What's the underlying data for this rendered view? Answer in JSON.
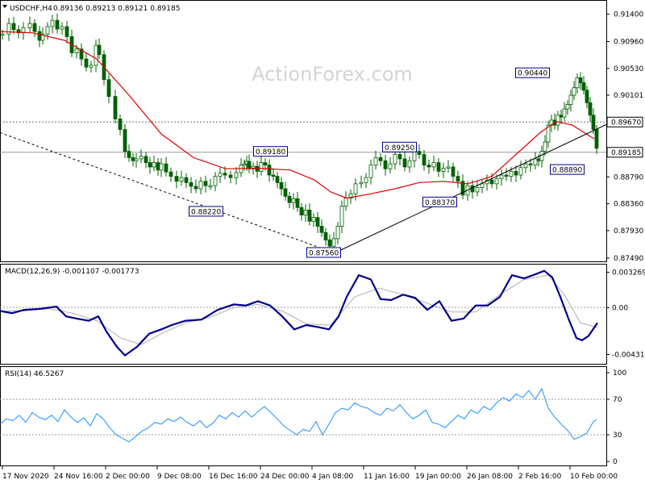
{
  "header": {
    "symbol": "USDCHF,H4",
    "ohlc": "0.89136 0.89213 0.89121 0.89185"
  },
  "watermark": "ActionForex.com",
  "colors": {
    "candle": "#006000",
    "ma": "#e00000",
    "macd": "#00008b",
    "signal": "#b0b0b0",
    "rsi": "#1e90ff",
    "trend": "#000000",
    "watermark": "#d4d4d4"
  },
  "chart_data": [
    {
      "type": "candlestick",
      "title": "USDCHF,H4",
      "ylim": [
        0.8745,
        0.916
      ],
      "price_ticks": [
        "0.91400",
        "0.90960",
        "0.90530",
        "0.90101",
        "0.89670",
        "0.89185",
        "0.88790",
        "0.88360",
        "0.87930",
        "0.87490"
      ],
      "x_labels": [
        "17 Nov 2020",
        "24 Nov 16:00",
        "2 Dec 00:00",
        "9 Dec 08:00",
        "16 Dec 16:00",
        "24 Dec 00:00",
        "4 Jan 08:00",
        "11 Jan 16:00",
        "19 Jan 00:00",
        "26 Jan 08:00",
        "2 Feb 16:00",
        "10 Feb 00:00"
      ],
      "close_series": {
        "x": [
          0,
          8,
          14,
          20,
          26,
          34,
          40,
          46,
          50,
          56,
          62,
          68,
          74,
          80,
          86,
          92,
          98,
          104,
          110,
          116,
          120,
          126,
          132,
          140,
          146,
          152,
          157,
          162,
          166,
          172,
          178,
          183,
          188,
          193,
          197,
          203,
          209,
          216,
          222,
          228,
          234,
          240,
          246,
          252,
          258,
          264,
          270,
          276,
          283,
          290,
          296,
          300,
          303,
          306,
          311,
          316,
          321,
          326,
          331,
          336,
          341,
          346,
          351,
          356,
          361,
          366,
          371,
          376,
          381,
          386,
          391,
          396,
          401,
          406,
          411,
          416,
          421,
          426,
          432,
          438,
          445,
          451,
          457,
          463,
          469,
          475,
          481,
          487,
          493,
          499,
          505,
          511,
          517,
          523,
          529,
          535,
          541,
          547,
          553,
          559,
          565,
          571,
          577,
          583,
          589,
          595,
          601,
          607,
          613,
          619,
          625,
          631,
          637,
          643,
          649,
          655,
          661,
          665,
          669,
          673,
          677,
          681,
          685,
          689,
          693,
          697,
          701,
          705,
          709,
          713,
          717,
          721,
          725,
          729,
          733,
          737
        ],
        "y": [
          0.9108,
          0.9125,
          0.9115,
          0.911,
          0.9118,
          0.9125,
          0.9112,
          0.9098,
          0.9108,
          0.912,
          0.913,
          0.9116,
          0.912,
          0.9104,
          0.9078,
          0.9084,
          0.9068,
          0.9055,
          0.9058,
          0.909,
          0.9075,
          0.9035,
          0.9008,
          0.8972,
          0.8955,
          0.892,
          0.891,
          0.8905,
          0.8908,
          0.8912,
          0.8902,
          0.8895,
          0.8902,
          0.889,
          0.89,
          0.8887,
          0.888,
          0.8872,
          0.8878,
          0.887,
          0.8864,
          0.886,
          0.8872,
          0.8865,
          0.8865,
          0.888,
          0.8885,
          0.8882,
          0.8878,
          0.8886,
          0.8898,
          0.89,
          0.8904,
          0.8892,
          0.8896,
          0.8888,
          0.8902,
          0.8898,
          0.8882,
          0.888,
          0.887,
          0.886,
          0.8848,
          0.8838,
          0.8844,
          0.883,
          0.8818,
          0.8826,
          0.8808,
          0.8814,
          0.88,
          0.879,
          0.8778,
          0.8768,
          0.878,
          0.88,
          0.8832,
          0.8845,
          0.8852,
          0.8868,
          0.887,
          0.8878,
          0.8898,
          0.891,
          0.8905,
          0.8892,
          0.89,
          0.8915,
          0.8908,
          0.8895,
          0.8905,
          0.892,
          0.8915,
          0.8898,
          0.8895,
          0.8902,
          0.8888,
          0.8893,
          0.8895,
          0.888,
          0.8872,
          0.885,
          0.8865,
          0.8855,
          0.8862,
          0.8868,
          0.8874,
          0.8868,
          0.8876,
          0.8882,
          0.888,
          0.8888,
          0.8882,
          0.8894,
          0.89,
          0.8898,
          0.8908,
          0.8905,
          0.892,
          0.8935,
          0.8962,
          0.897,
          0.8962,
          0.8978,
          0.8975,
          0.8988,
          0.8995,
          0.901,
          0.9022,
          0.9038,
          0.903,
          0.9018,
          0.8998,
          0.8978,
          0.8955,
          0.8925
        ]
      },
      "moving_average": {
        "x": [
          0,
          40,
          80,
          120,
          160,
          200,
          240,
          280,
          320,
          360,
          390,
          410,
          430,
          460,
          490,
          520,
          550,
          580,
          610,
          640,
          670,
          690,
          710,
          737
        ],
        "y": [
          0.9112,
          0.911,
          0.9098,
          0.9068,
          0.901,
          0.8948,
          0.891,
          0.8892,
          0.8893,
          0.889,
          0.8874,
          0.8855,
          0.8845,
          0.8852,
          0.886,
          0.887,
          0.8872,
          0.8868,
          0.888,
          0.8915,
          0.895,
          0.8968,
          0.8962,
          0.894
        ]
      },
      "trendlines": [
        {
          "from": [
            0,
            0.895
          ],
          "to": [
            413,
            0.8758
          ]
        },
        {
          "from": [
            413,
            0.8756
          ],
          "to": [
            752,
            0.8963
          ]
        }
      ],
      "horizontal_levels": [
        0.8967,
        0.89185
      ],
      "annotations": [
        {
          "label": "0.89180",
          "at": [
            315,
            0.8918
          ]
        },
        {
          "label": "0.89250",
          "at": [
            475,
            0.8925
          ]
        },
        {
          "label": "0.90440",
          "at": [
            640,
            0.9044
          ]
        },
        {
          "label": "0.88220",
          "at": [
            235,
            0.8822
          ]
        },
        {
          "label": "0.88370",
          "at": [
            525,
            0.8837
          ]
        },
        {
          "label": "0.87560",
          "at": [
            381,
            0.8756
          ]
        },
        {
          "label": "0.88890",
          "at": [
            683,
            0.8889
          ]
        }
      ],
      "current_price": "0.89185",
      "level_label": "0.89670"
    },
    {
      "type": "line",
      "title": "MACD(12,26,9) -0.001107 -0.001773",
      "ylim": [
        -0.0048,
        0.0036
      ],
      "y_ticks": [
        "0.003269",
        "0.00",
        "-0.004316"
      ],
      "series": [
        {
          "name": "MACD",
          "x": [
            0,
            15,
            30,
            50,
            70,
            82,
            95,
            110,
            122,
            132,
            145,
            155,
            170,
            185,
            200,
            213,
            230,
            250,
            270,
            290,
            305,
            320,
            335,
            350,
            365,
            380,
            395,
            408,
            420,
            430,
            445,
            460,
            472,
            485,
            500,
            515,
            530,
            545,
            560,
            575,
            590,
            605,
            620,
            635,
            650,
            665,
            675,
            685,
            695,
            705,
            715,
            722,
            730,
            741
          ],
          "y": [
            -0.0003,
            -0.0005,
            -0.0002,
            -0.0001,
            0.0001,
            -0.0008,
            -0.001,
            -0.0012,
            -0.0008,
            -0.0022,
            -0.0036,
            -0.0044,
            -0.0036,
            -0.0024,
            -0.002,
            -0.0016,
            -0.0012,
            -0.0011,
            -0.0002,
            0.0003,
            0.0002,
            0.0006,
            0.0002,
            -0.0008,
            -0.002,
            -0.0016,
            -0.0018,
            -0.002,
            -0.0008,
            0.001,
            0.003,
            0.0026,
            0.0008,
            0.0007,
            0.0012,
            0.0009,
            -0.0002,
            0.0006,
            -0.0012,
            -0.001,
            0.0002,
            0.0002,
            0.001,
            0.003,
            0.0027,
            0.0031,
            0.0034,
            0.0028,
            0.001,
            -0.001,
            -0.0028,
            -0.003,
            -0.0026,
            -0.0014
          ]
        },
        {
          "name": "Signal",
          "x": [
            0,
            30,
            60,
            90,
            120,
            150,
            175,
            200,
            230,
            260,
            290,
            320,
            350,
            380,
            410,
            440,
            470,
            500,
            530,
            560,
            590,
            620,
            650,
            680,
            700,
            720,
            741
          ],
          "y": [
            -0.0003,
            -0.0003,
            -0.0001,
            -0.0005,
            -0.0012,
            -0.0028,
            -0.0034,
            -0.0024,
            -0.0014,
            -0.0009,
            0.0,
            0.0003,
            -0.0003,
            -0.0015,
            -0.0016,
            0.001,
            0.0018,
            0.0012,
            0.0004,
            -0.0004,
            -0.0004,
            0.0012,
            0.0026,
            0.003,
            0.0012,
            -0.0014,
            -0.0018
          ]
        }
      ]
    },
    {
      "type": "line",
      "title": "RSI(14) 46.5267",
      "ylim": [
        0,
        100
      ],
      "y_ticks": [
        "100",
        "70",
        "30",
        "0"
      ],
      "levels": [
        70,
        30
      ],
      "series": [
        {
          "name": "RSI",
          "x": [
            0,
            8,
            16,
            24,
            32,
            40,
            48,
            56,
            64,
            72,
            80,
            88,
            96,
            104,
            112,
            120,
            128,
            136,
            144,
            152,
            160,
            168,
            176,
            184,
            192,
            200,
            208,
            216,
            224,
            232,
            240,
            248,
            256,
            264,
            272,
            280,
            288,
            296,
            304,
            312,
            320,
            328,
            336,
            344,
            352,
            360,
            368,
            376,
            384,
            392,
            400,
            408,
            416,
            424,
            432,
            440,
            448,
            456,
            464,
            472,
            480,
            488,
            496,
            504,
            512,
            520,
            528,
            536,
            544,
            552,
            560,
            568,
            576,
            584,
            592,
            600,
            608,
            616,
            624,
            632,
            640,
            648,
            656,
            664,
            672,
            680,
            688,
            696,
            704,
            712,
            720,
            728,
            736,
            740
          ],
          "y": [
            42,
            48,
            46,
            52,
            44,
            55,
            50,
            47,
            52,
            45,
            58,
            50,
            44,
            49,
            40,
            54,
            48,
            38,
            30,
            26,
            22,
            28,
            34,
            38,
            44,
            42,
            48,
            45,
            50,
            44,
            40,
            46,
            38,
            43,
            52,
            48,
            55,
            50,
            57,
            50,
            56,
            62,
            55,
            48,
            40,
            35,
            30,
            36,
            34,
            45,
            30,
            42,
            55,
            60,
            58,
            66,
            62,
            60,
            55,
            52,
            60,
            57,
            64,
            55,
            48,
            52,
            58,
            44,
            42,
            38,
            45,
            52,
            48,
            58,
            54,
            62,
            58,
            66,
            72,
            68,
            76,
            72,
            80,
            70,
            82,
            60,
            50,
            42,
            35,
            25,
            28,
            32,
            45,
            47
          ]
        }
      ]
    }
  ]
}
